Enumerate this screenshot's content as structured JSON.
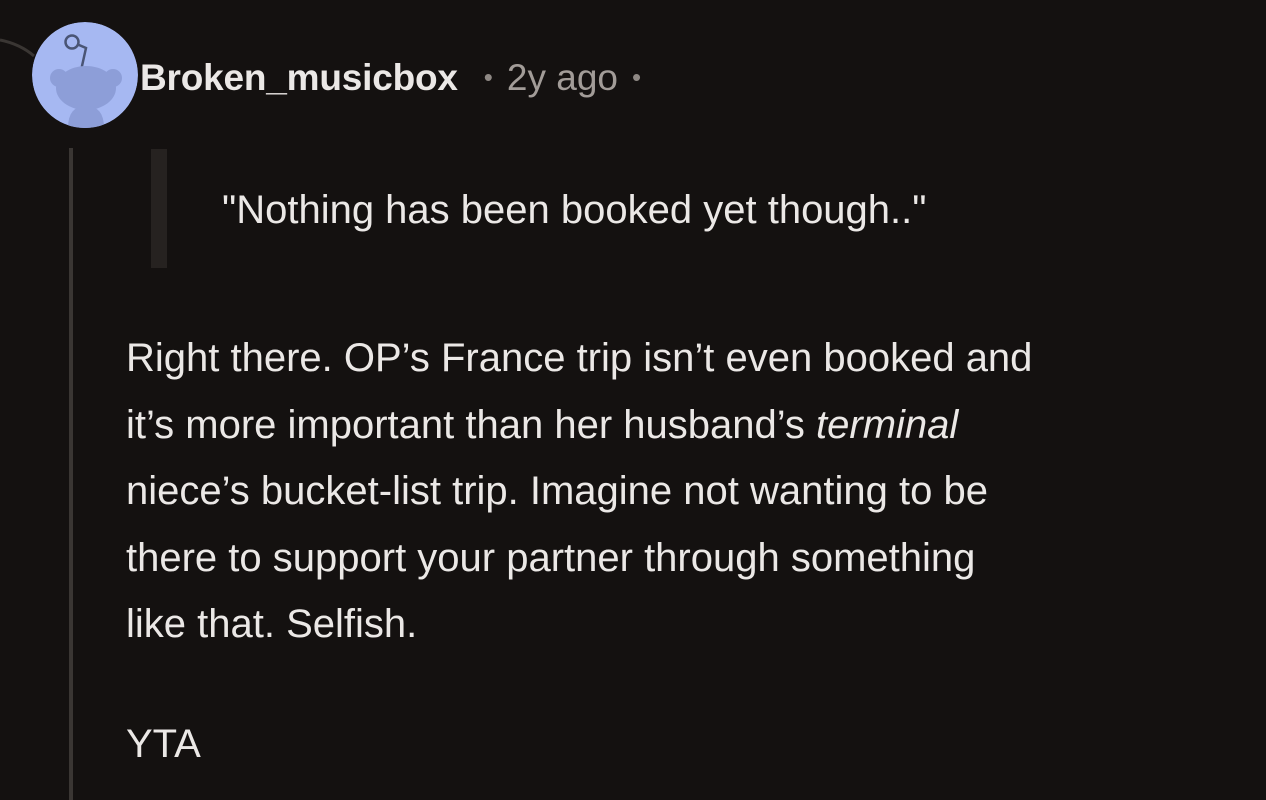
{
  "comment": {
    "author": "Broken_musicbox",
    "age": "2y ago",
    "separator": "•",
    "avatar_icon": "snoo-avatar-icon",
    "quote": "\"Nothing has been booked yet though..\"",
    "body": {
      "line1": "Right there. OP’s France trip isn’t even booked and",
      "line2_before": "it’s more important than her husband’s ",
      "line2_emphasis": "terminal",
      "line3": "niece’s bucket-list trip. Imagine not wanting to be",
      "line4": "there to support your partner through something",
      "line5": "like that. Selfish."
    },
    "verdict": "YTA"
  },
  "colors": {
    "background": "#141110",
    "text": "#ebe8e6",
    "meta": "#a29c98",
    "avatar_bg": "#a6b8f2",
    "thread_line": "#3a3633",
    "quote_bar": "#262220"
  }
}
